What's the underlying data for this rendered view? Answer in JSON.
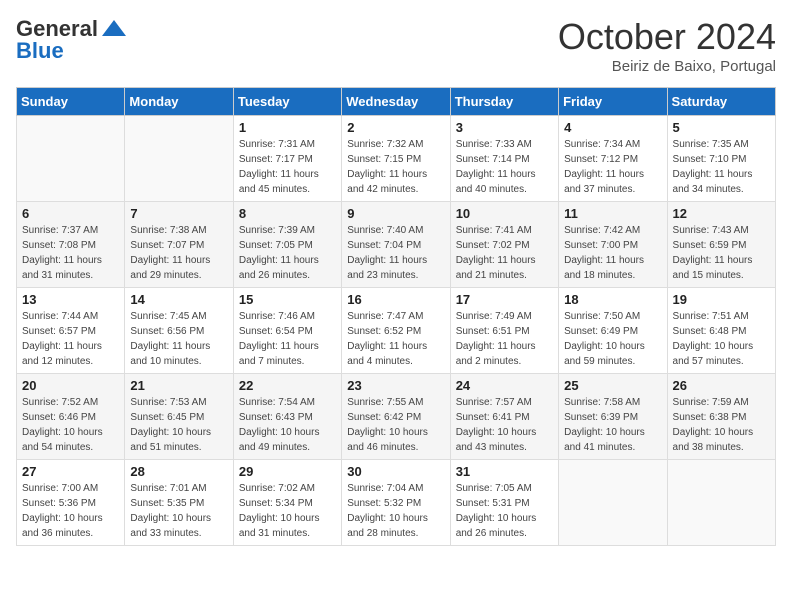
{
  "header": {
    "logo_general": "General",
    "logo_blue": "Blue",
    "month_title": "October 2024",
    "location": "Beiriz de Baixo, Portugal"
  },
  "weekdays": [
    "Sunday",
    "Monday",
    "Tuesday",
    "Wednesday",
    "Thursday",
    "Friday",
    "Saturday"
  ],
  "weeks": [
    [
      {
        "day": "",
        "sunrise": "",
        "sunset": "",
        "daylight": ""
      },
      {
        "day": "",
        "sunrise": "",
        "sunset": "",
        "daylight": ""
      },
      {
        "day": "1",
        "sunrise": "Sunrise: 7:31 AM",
        "sunset": "Sunset: 7:17 PM",
        "daylight": "Daylight: 11 hours and 45 minutes."
      },
      {
        "day": "2",
        "sunrise": "Sunrise: 7:32 AM",
        "sunset": "Sunset: 7:15 PM",
        "daylight": "Daylight: 11 hours and 42 minutes."
      },
      {
        "day": "3",
        "sunrise": "Sunrise: 7:33 AM",
        "sunset": "Sunset: 7:14 PM",
        "daylight": "Daylight: 11 hours and 40 minutes."
      },
      {
        "day": "4",
        "sunrise": "Sunrise: 7:34 AM",
        "sunset": "Sunset: 7:12 PM",
        "daylight": "Daylight: 11 hours and 37 minutes."
      },
      {
        "day": "5",
        "sunrise": "Sunrise: 7:35 AM",
        "sunset": "Sunset: 7:10 PM",
        "daylight": "Daylight: 11 hours and 34 minutes."
      }
    ],
    [
      {
        "day": "6",
        "sunrise": "Sunrise: 7:37 AM",
        "sunset": "Sunset: 7:08 PM",
        "daylight": "Daylight: 11 hours and 31 minutes."
      },
      {
        "day": "7",
        "sunrise": "Sunrise: 7:38 AM",
        "sunset": "Sunset: 7:07 PM",
        "daylight": "Daylight: 11 hours and 29 minutes."
      },
      {
        "day": "8",
        "sunrise": "Sunrise: 7:39 AM",
        "sunset": "Sunset: 7:05 PM",
        "daylight": "Daylight: 11 hours and 26 minutes."
      },
      {
        "day": "9",
        "sunrise": "Sunrise: 7:40 AM",
        "sunset": "Sunset: 7:04 PM",
        "daylight": "Daylight: 11 hours and 23 minutes."
      },
      {
        "day": "10",
        "sunrise": "Sunrise: 7:41 AM",
        "sunset": "Sunset: 7:02 PM",
        "daylight": "Daylight: 11 hours and 21 minutes."
      },
      {
        "day": "11",
        "sunrise": "Sunrise: 7:42 AM",
        "sunset": "Sunset: 7:00 PM",
        "daylight": "Daylight: 11 hours and 18 minutes."
      },
      {
        "day": "12",
        "sunrise": "Sunrise: 7:43 AM",
        "sunset": "Sunset: 6:59 PM",
        "daylight": "Daylight: 11 hours and 15 minutes."
      }
    ],
    [
      {
        "day": "13",
        "sunrise": "Sunrise: 7:44 AM",
        "sunset": "Sunset: 6:57 PM",
        "daylight": "Daylight: 11 hours and 12 minutes."
      },
      {
        "day": "14",
        "sunrise": "Sunrise: 7:45 AM",
        "sunset": "Sunset: 6:56 PM",
        "daylight": "Daylight: 11 hours and 10 minutes."
      },
      {
        "day": "15",
        "sunrise": "Sunrise: 7:46 AM",
        "sunset": "Sunset: 6:54 PM",
        "daylight": "Daylight: 11 hours and 7 minutes."
      },
      {
        "day": "16",
        "sunrise": "Sunrise: 7:47 AM",
        "sunset": "Sunset: 6:52 PM",
        "daylight": "Daylight: 11 hours and 4 minutes."
      },
      {
        "day": "17",
        "sunrise": "Sunrise: 7:49 AM",
        "sunset": "Sunset: 6:51 PM",
        "daylight": "Daylight: 11 hours and 2 minutes."
      },
      {
        "day": "18",
        "sunrise": "Sunrise: 7:50 AM",
        "sunset": "Sunset: 6:49 PM",
        "daylight": "Daylight: 10 hours and 59 minutes."
      },
      {
        "day": "19",
        "sunrise": "Sunrise: 7:51 AM",
        "sunset": "Sunset: 6:48 PM",
        "daylight": "Daylight: 10 hours and 57 minutes."
      }
    ],
    [
      {
        "day": "20",
        "sunrise": "Sunrise: 7:52 AM",
        "sunset": "Sunset: 6:46 PM",
        "daylight": "Daylight: 10 hours and 54 minutes."
      },
      {
        "day": "21",
        "sunrise": "Sunrise: 7:53 AM",
        "sunset": "Sunset: 6:45 PM",
        "daylight": "Daylight: 10 hours and 51 minutes."
      },
      {
        "day": "22",
        "sunrise": "Sunrise: 7:54 AM",
        "sunset": "Sunset: 6:43 PM",
        "daylight": "Daylight: 10 hours and 49 minutes."
      },
      {
        "day": "23",
        "sunrise": "Sunrise: 7:55 AM",
        "sunset": "Sunset: 6:42 PM",
        "daylight": "Daylight: 10 hours and 46 minutes."
      },
      {
        "day": "24",
        "sunrise": "Sunrise: 7:57 AM",
        "sunset": "Sunset: 6:41 PM",
        "daylight": "Daylight: 10 hours and 43 minutes."
      },
      {
        "day": "25",
        "sunrise": "Sunrise: 7:58 AM",
        "sunset": "Sunset: 6:39 PM",
        "daylight": "Daylight: 10 hours and 41 minutes."
      },
      {
        "day": "26",
        "sunrise": "Sunrise: 7:59 AM",
        "sunset": "Sunset: 6:38 PM",
        "daylight": "Daylight: 10 hours and 38 minutes."
      }
    ],
    [
      {
        "day": "27",
        "sunrise": "Sunrise: 7:00 AM",
        "sunset": "Sunset: 5:36 PM",
        "daylight": "Daylight: 10 hours and 36 minutes."
      },
      {
        "day": "28",
        "sunrise": "Sunrise: 7:01 AM",
        "sunset": "Sunset: 5:35 PM",
        "daylight": "Daylight: 10 hours and 33 minutes."
      },
      {
        "day": "29",
        "sunrise": "Sunrise: 7:02 AM",
        "sunset": "Sunset: 5:34 PM",
        "daylight": "Daylight: 10 hours and 31 minutes."
      },
      {
        "day": "30",
        "sunrise": "Sunrise: 7:04 AM",
        "sunset": "Sunset: 5:32 PM",
        "daylight": "Daylight: 10 hours and 28 minutes."
      },
      {
        "day": "31",
        "sunrise": "Sunrise: 7:05 AM",
        "sunset": "Sunset: 5:31 PM",
        "daylight": "Daylight: 10 hours and 26 minutes."
      },
      {
        "day": "",
        "sunrise": "",
        "sunset": "",
        "daylight": ""
      },
      {
        "day": "",
        "sunrise": "",
        "sunset": "",
        "daylight": ""
      }
    ]
  ]
}
